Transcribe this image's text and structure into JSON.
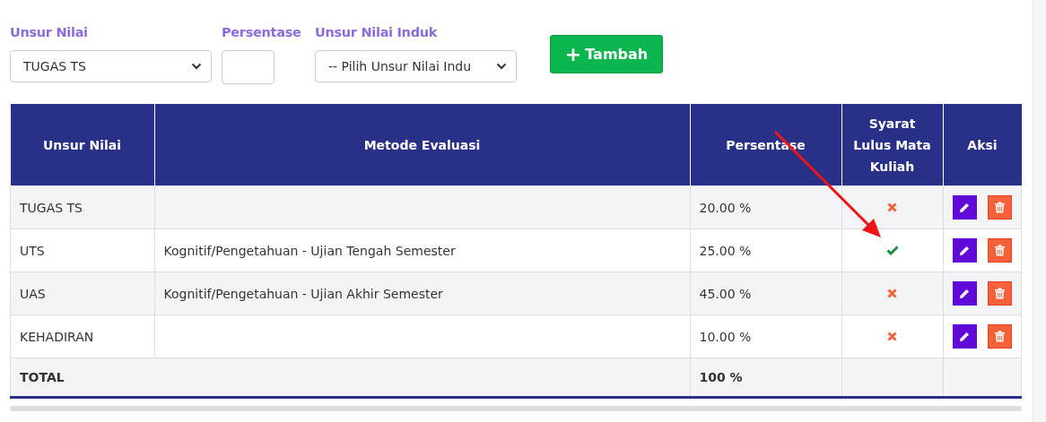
{
  "form": {
    "fields": [
      {
        "kind": "select",
        "label": "Unsur Nilai",
        "value": "TUGAS TS"
      },
      {
        "kind": "input",
        "label": "Persentase"
      },
      {
        "kind": "select",
        "label": "Unsur Nilai Induk",
        "value": "-- Pilih Unsur Nilai Indu"
      }
    ],
    "add_button": {
      "icon": "+",
      "label": "Tambah"
    }
  },
  "table": {
    "columns": [
      "Unsur Nilai",
      "Metode Evaluasi",
      "Persentase",
      "Syarat Lulus Mata Kuliah",
      "Aksi"
    ],
    "rows": [
      {
        "unsur": "TUGAS TS",
        "metode": "",
        "persentase": "20.00 %",
        "syarat": false
      },
      {
        "unsur": "UTS",
        "metode": "Kognitif/Pengetahuan - Ujian Tengah Semester",
        "persentase": "25.00 %",
        "syarat": true
      },
      {
        "unsur": "UAS",
        "metode": "Kognitif/Pengetahuan - Ujian Akhir Semester",
        "persentase": "45.00 %",
        "syarat": false
      },
      {
        "unsur": "KEHADIRAN",
        "metode": "",
        "persentase": "10.00 %",
        "syarat": false
      }
    ],
    "total": {
      "label": "TOTAL",
      "persentase": "100 %"
    }
  }
}
